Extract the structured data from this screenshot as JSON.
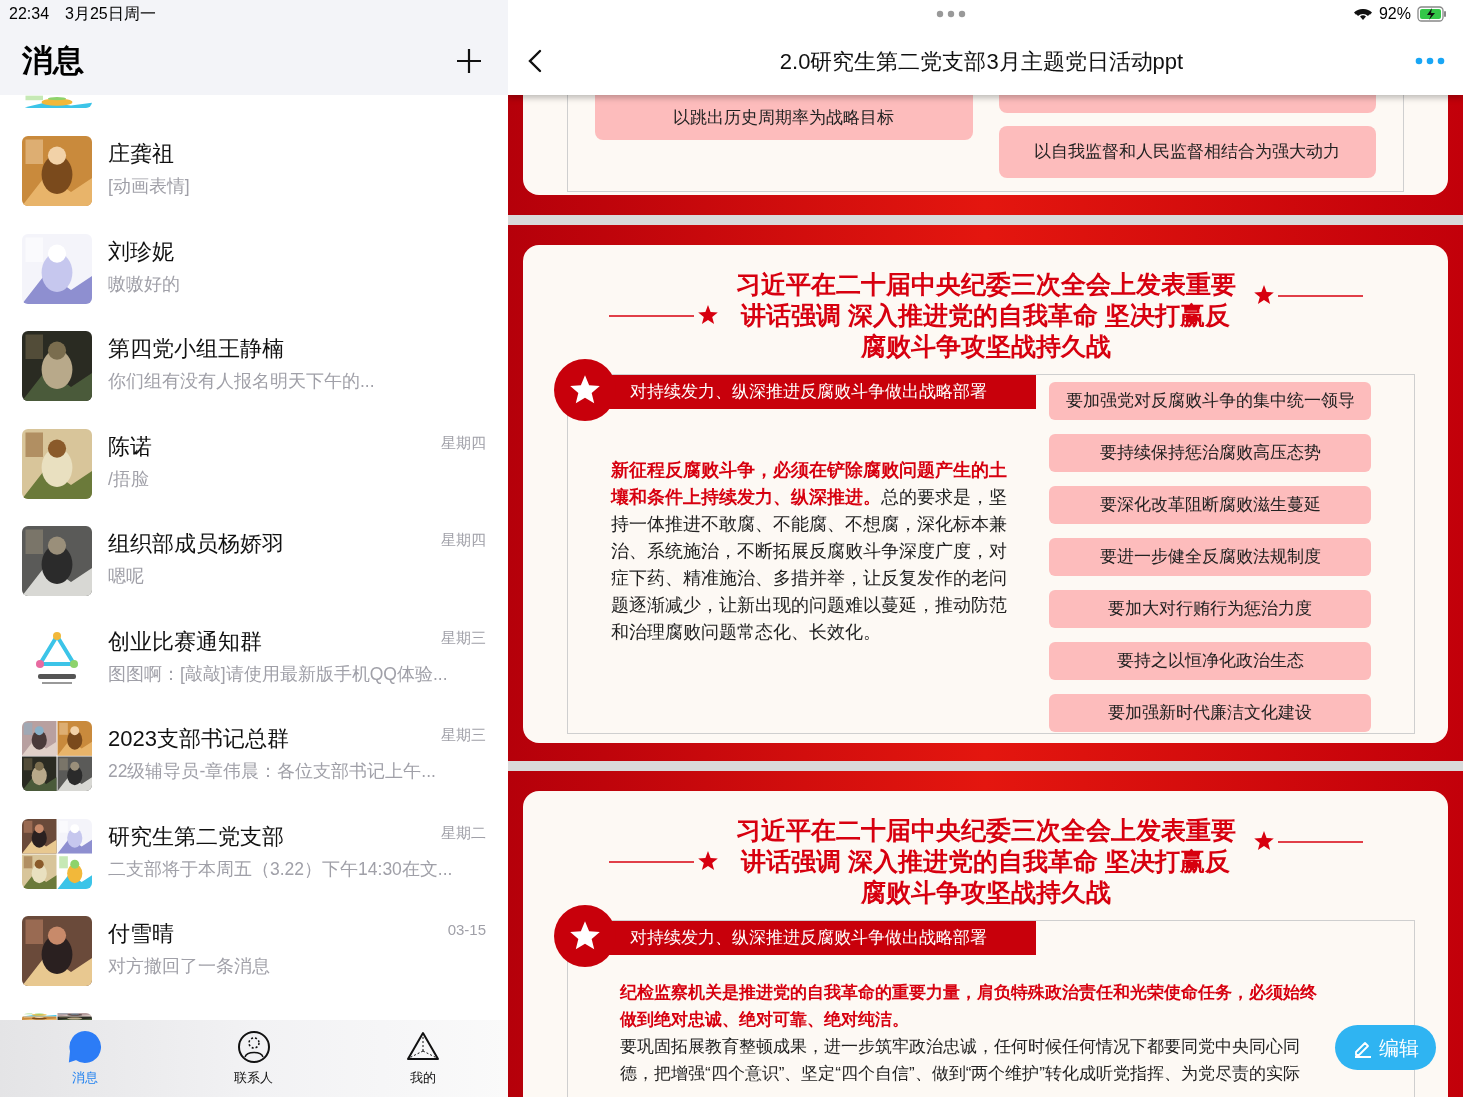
{
  "status_bar": {
    "time": "22:34",
    "date": "3月25日周一",
    "battery": "92%"
  },
  "chat_list": {
    "title": "消息",
    "chats": [
      {
        "name": "庄龚祖",
        "preview": "[动画表情]"
      },
      {
        "name": "刘珍妮",
        "preview": "嗷嗷好的"
      },
      {
        "name": "第四党小组王静楠",
        "preview": "你们组有没有人报名明天下午的..."
      },
      {
        "name": "陈诺",
        "preview": "/捂脸",
        "time": "星期四"
      },
      {
        "name": "组织部成员杨娇羽",
        "preview": "嗯呢",
        "time": "星期四"
      },
      {
        "name": "创业比赛通知群",
        "preview": "图图啊：[敲敲]请使用最新版手机QQ体验...",
        "time": "星期三",
        "kind": "logo"
      },
      {
        "name": "2023支部书记总群",
        "preview": "22级辅导员-章伟晨：各位支部书记上午...",
        "time": "星期三",
        "kind": "collage"
      },
      {
        "name": "研究生第二党支部",
        "preview": "二支部将于本周五（3.22）下午14:30在文...",
        "time": "星期二",
        "kind": "collage"
      },
      {
        "name": "付雪晴",
        "preview": "对方撤回了一条消息",
        "time": "03-15"
      }
    ]
  },
  "tab_bar": [
    {
      "label": "消息",
      "kind": "chat",
      "selected": true
    },
    {
      "label": "联系人",
      "kind": "contacts",
      "selected": false
    },
    {
      "label": "我的",
      "kind": "me",
      "selected": false
    }
  ],
  "document": {
    "title": "2.0研究生第二党支部3月主题党日活动ppt",
    "slides": [
      {
        "kind": "partial",
        "points": [
          "以跳出历史周期率为战略目标",
          "以自我监督和人民监督相结合为强大动力"
        ]
      },
      {
        "kind": "points",
        "title": "习近平在二十届中央纪委三次全会上发表重要讲话强调 深入推进党的自我革命 坚决打赢反腐败斗争攻坚战持久战",
        "banner": "对持续发力、纵深推进反腐败斗争做出战略部署",
        "paragraph": "**新征程反腐败斗争，必须在铲除腐败问题产生的土壤和条件上持续发力、纵深推进。**总的要求是，坚持一体推进不敢腐、不能腐、不想腐，深化标本兼治、系统施治，不断拓展反腐败斗争深度广度，对症下药、精准施治、多措并举，让反复发作的老问题逐渐减少，让新出现的问题难以蔓延，推动防范和治理腐败问题常态化、长效化。",
        "points": [
          "要加强党对反腐败斗争的集中统一领导",
          "要持续保持惩治腐败高压态势",
          "要深化改革阻断腐败滋生蔓延",
          "要进一步健全反腐败法规制度",
          "要加大对行贿行为惩治力度",
          "要持之以恒净化政治生态",
          "要加强新时代廉洁文化建设"
        ]
      },
      {
        "kind": "text",
        "title": "习近平在二十届中央纪委三次全会上发表重要讲话强调 深入推进党的自我革命 坚决打赢反腐败斗争攻坚战持久战",
        "banner": "对持续发力、纵深推进反腐败斗争做出战略部署",
        "lead": "纪检监察机关是推进党的自我革命的重要力量，肩负特殊政治责任和光荣使命任务，必须始终做到绝对忠诚、绝对可靠、绝对纯洁。",
        "body": "要巩固拓展教育整顿成果，进一步筑牢政治忠诚，任何时候任何情况下都要同党中央同心同德，把增强“四个意识”、坚定“四个自信”、做到“两个维护”转化成听党指挥、为党尽责的实际"
      }
    ]
  },
  "edit_button": {
    "label": "编辑"
  }
}
